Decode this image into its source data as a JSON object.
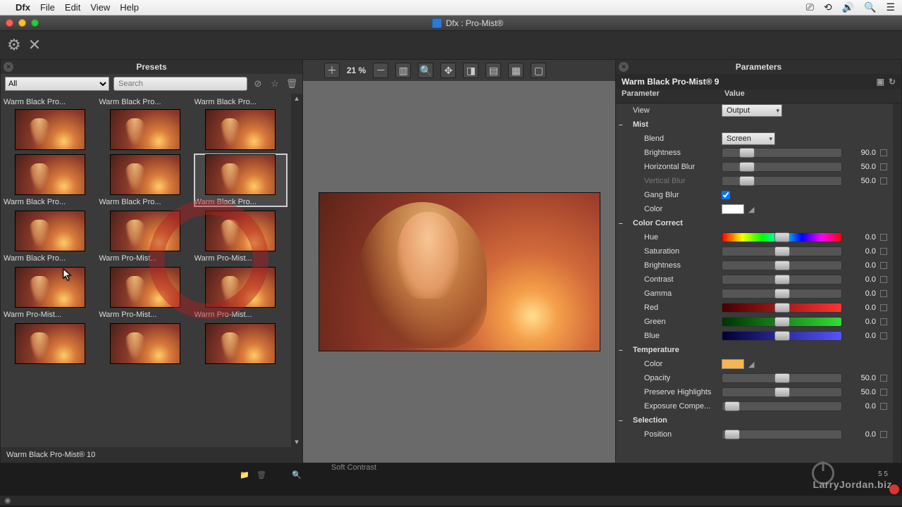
{
  "menubar": {
    "app": "Dfx",
    "items": [
      "File",
      "Edit",
      "View",
      "Help"
    ]
  },
  "window_title": "Dfx : Pro-Mist®",
  "toolbar": {
    "gear": "⚙",
    "close": "✕"
  },
  "presets": {
    "title": "Presets",
    "filter_all": "All",
    "search_placeholder": "Search",
    "items": [
      {
        "label": "Warm Black Pro...",
        "sel": false
      },
      {
        "label": "Warm Black Pro...",
        "sel": false
      },
      {
        "label": "Warm Black Pro...",
        "sel": false
      },
      {
        "label": "Warm Black Pro...",
        "sel": false
      },
      {
        "label": "Warm Black Pro...",
        "sel": false
      },
      {
        "label": "Warm Black Pro...",
        "sel": true
      },
      {
        "label": "Warm Black Pro...",
        "sel": false
      },
      {
        "label": "Warm Pro-Mist...",
        "sel": false
      },
      {
        "label": "Warm Pro-Mist...",
        "sel": false
      },
      {
        "label": "Warm Pro-Mist...",
        "sel": false
      },
      {
        "label": "Warm Pro-Mist...",
        "sel": false
      },
      {
        "label": "Warm Pro-Mist...",
        "sel": false
      },
      {
        "label": "",
        "sel": false
      },
      {
        "label": "",
        "sel": false
      },
      {
        "label": "",
        "sel": false
      }
    ],
    "status": "Warm Black Pro-Mist® 10"
  },
  "viewer": {
    "zoom": "21 %"
  },
  "parameters": {
    "title": "Parameters",
    "effect_name": "Warm Black Pro-Mist® 9",
    "col_param": "Parameter",
    "col_value": "Value",
    "view_label": "View",
    "view_value": "Output",
    "groups": {
      "mist": "Mist",
      "colorcorrect": "Color Correct",
      "temperature": "Temperature",
      "selection": "Selection"
    },
    "mist": {
      "blend_label": "Blend",
      "blend_value": "Screen",
      "brightness_label": "Brightness",
      "brightness_value": "90.0",
      "hblur_label": "Horizontal Blur",
      "hblur_value": "50.0",
      "vblur_label": "Vertical Blur",
      "vblur_value": "50.0",
      "gang_label": "Gang Blur",
      "color_label": "Color"
    },
    "cc": {
      "hue_label": "Hue",
      "hue_value": "0.0",
      "sat_label": "Saturation",
      "sat_value": "0.0",
      "bri_label": "Brightness",
      "bri_value": "0.0",
      "con_label": "Contrast",
      "con_value": "0.0",
      "gam_label": "Gamma",
      "gam_value": "0.0",
      "red_label": "Red",
      "red_value": "0.0",
      "grn_label": "Green",
      "grn_value": "0.0",
      "blu_label": "Blue",
      "blu_value": "0.0"
    },
    "temp": {
      "color_label": "Color",
      "opacity_label": "Opacity",
      "opacity_value": "50.0",
      "preserve_label": "Preserve Highlights",
      "preserve_value": "50.0",
      "exposure_label": "Exposure Compe...",
      "exposure_value": "0.0"
    },
    "sel": {
      "position_label": "Position",
      "position_value": "0.0"
    }
  },
  "bottom": {
    "soft_contrast": "Soft Contrast",
    "watermark": "LarryJordan.biz",
    "counter": "5  5"
  },
  "colors": {
    "accent": "#2b7bd6"
  }
}
